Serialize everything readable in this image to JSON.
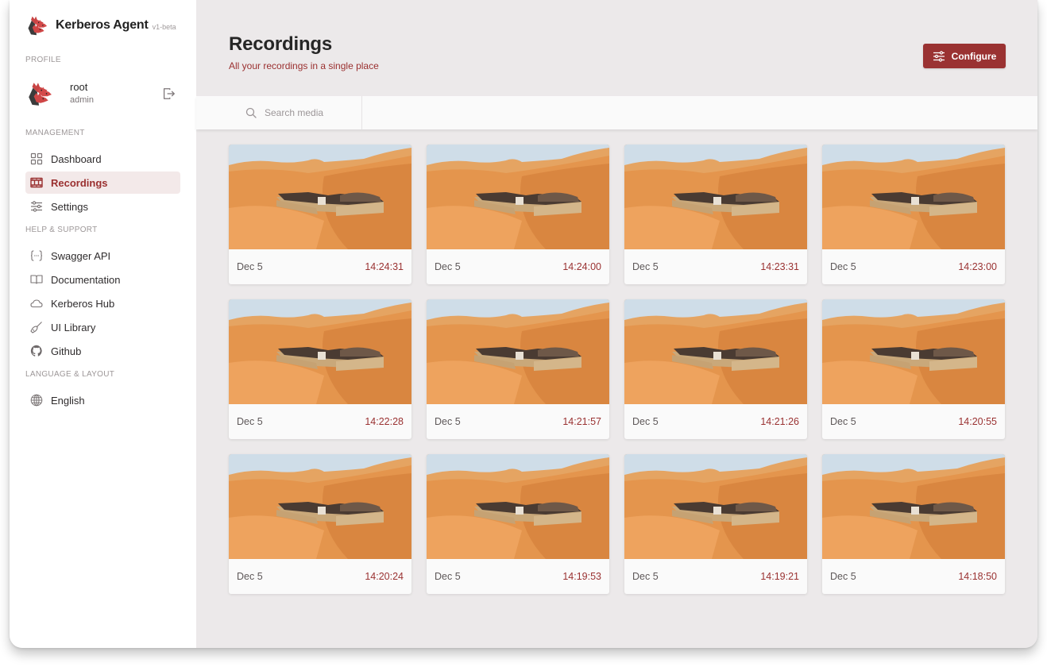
{
  "app": {
    "name": "Kerberos Agent",
    "version": "v1-beta",
    "logo_icon": "kerberos-dog-logo"
  },
  "colors": {
    "accent": "#9a3232",
    "active_bg": "#f3e9e9",
    "main_bg": "#ece9ea",
    "sidebar_bg": "#ffffff"
  },
  "sidebar": {
    "profile_title": "PROFILE",
    "user": {
      "name": "root",
      "role": "admin"
    },
    "management_title": "MANAGEMENT",
    "management_items": [
      {
        "label": "Dashboard",
        "icon": "dashboard-grid-icon",
        "active": false
      },
      {
        "label": "Recordings",
        "icon": "film-icon",
        "active": true
      },
      {
        "label": "Settings",
        "icon": "sliders-icon",
        "active": false
      }
    ],
    "help_title": "HELP & SUPPORT",
    "help_items": [
      {
        "label": "Swagger API",
        "icon": "code-braces-icon"
      },
      {
        "label": "Documentation",
        "icon": "book-icon"
      },
      {
        "label": "Kerberos Hub",
        "icon": "cloud-icon"
      },
      {
        "label": "UI Library",
        "icon": "brush-icon"
      },
      {
        "label": "Github",
        "icon": "github-icon"
      }
    ],
    "language_title": "LANGUAGE & LAYOUT",
    "language_items": [
      {
        "label": "English",
        "icon": "globe-icon"
      }
    ]
  },
  "header": {
    "title": "Recordings",
    "subtitle": "All your recordings in a single place",
    "configure_label": "Configure"
  },
  "search": {
    "placeholder": "Search media",
    "value": ""
  },
  "recordings": [
    {
      "date": "Dec 5",
      "time": "14:24:31"
    },
    {
      "date": "Dec 5",
      "time": "14:24:00"
    },
    {
      "date": "Dec 5",
      "time": "14:23:31"
    },
    {
      "date": "Dec 5",
      "time": "14:23:00"
    },
    {
      "date": "Dec 5",
      "time": "14:22:28"
    },
    {
      "date": "Dec 5",
      "time": "14:21:57"
    },
    {
      "date": "Dec 5",
      "time": "14:21:26"
    },
    {
      "date": "Dec 5",
      "time": "14:20:55"
    },
    {
      "date": "Dec 5",
      "time": "14:20:24"
    },
    {
      "date": "Dec 5",
      "time": "14:19:53"
    },
    {
      "date": "Dec 5",
      "time": "14:19:21"
    },
    {
      "date": "Dec 5",
      "time": "14:18:50"
    }
  ]
}
